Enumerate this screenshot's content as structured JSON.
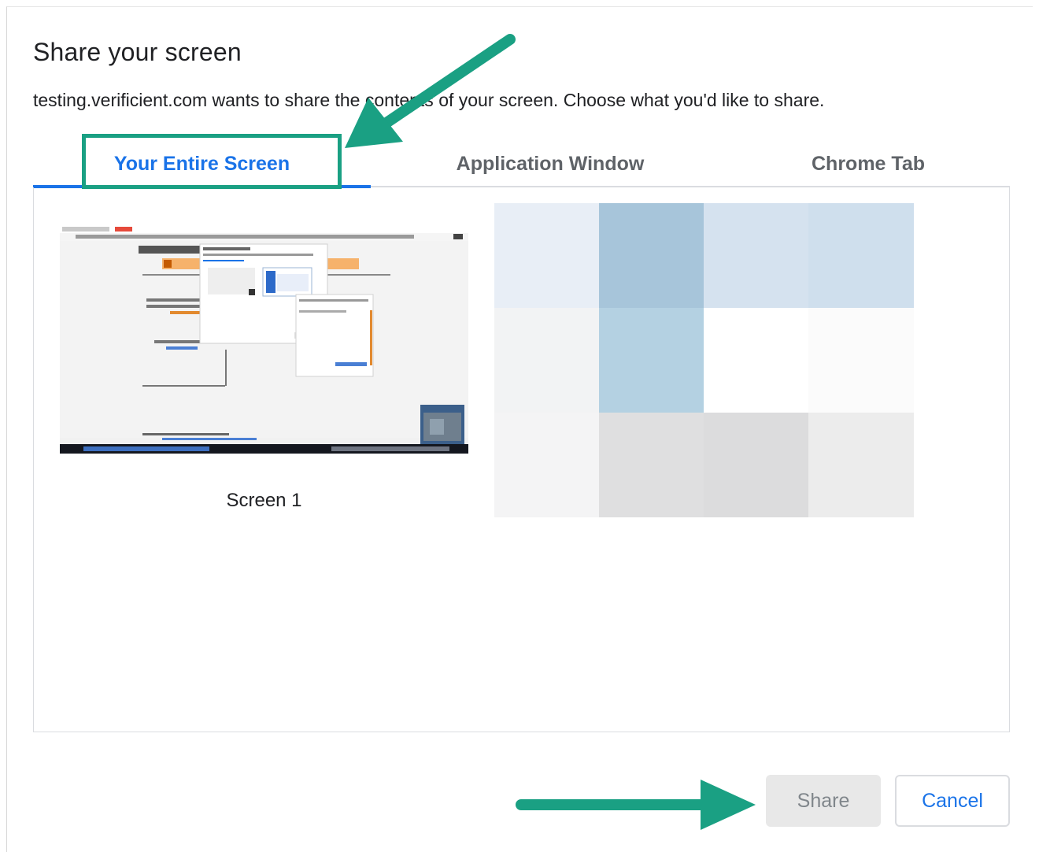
{
  "dialog": {
    "title": "Share your screen",
    "subtitle": "testing.verificient.com wants to share the contents of your screen. Choose what you'd like to share."
  },
  "tabs": [
    {
      "label": "Your Entire Screen",
      "active": true
    },
    {
      "label": "Application Window",
      "active": false
    },
    {
      "label": "Chrome Tab",
      "active": false
    }
  ],
  "sources": [
    {
      "label": "Screen 1",
      "selected": false
    }
  ],
  "buttons": {
    "share_label": "Share",
    "share_enabled": false,
    "cancel_label": "Cancel"
  },
  "colors": {
    "accent": "#1a73e8",
    "annotation": "#1aa083",
    "mosaic": [
      "#e8eef6",
      "#a7c5da",
      "#d5e2ef",
      "#cfdfed",
      "#f2f3f4",
      "#b4d1e2",
      "#ffffff",
      "#fbfbfb",
      "#f4f4f5",
      "#dfdfe0",
      "#dcdcdd",
      "#ececec"
    ]
  },
  "annotations": {
    "icons": [
      "arrow-to-tab-icon",
      "arrow-to-share-icon"
    ]
  }
}
